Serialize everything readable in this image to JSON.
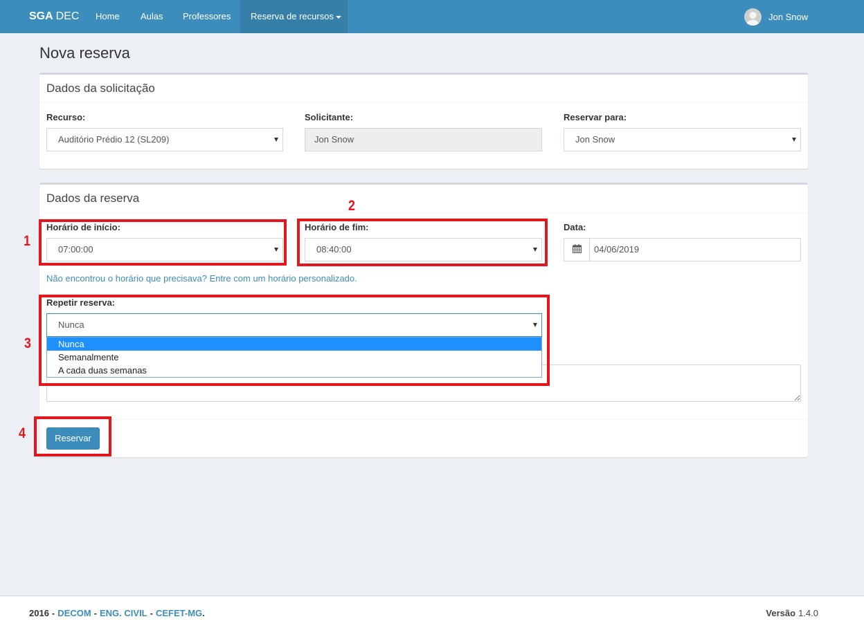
{
  "colors": {
    "navbar": "#3c8dbc",
    "navbar_active": "#367fa9",
    "primary": "#3c8dbc",
    "option_highlight": "#1e90ff",
    "annotation": "#e3161e",
    "page_bg": "#ecf0f5"
  },
  "navbar": {
    "brand": {
      "bold": "SGA",
      "rest": "DEC"
    },
    "items": [
      {
        "label": "Home"
      },
      {
        "label": "Aulas"
      },
      {
        "label": "Professores"
      },
      {
        "label": "Reserva de recursos",
        "active": true,
        "icon": "caret-down-icon"
      }
    ],
    "user": {
      "name": "Jon Snow",
      "icon": "user-avatar-icon"
    }
  },
  "page": {
    "title": "Nova reserva"
  },
  "box_solicitacao": {
    "title": "Dados da solicitação",
    "recurso": {
      "label": "Recurso:",
      "value": "Auditório Prédio 12 (SL209)"
    },
    "solicitante": {
      "label": "Solicitante:",
      "value": "Jon Snow",
      "disabled": true
    },
    "reservar_para": {
      "label": "Reservar para:",
      "value": "Jon Snow"
    }
  },
  "box_reserva": {
    "title": "Dados da reserva",
    "horario_inicio": {
      "label": "Horário de início:",
      "value": "07:00:00"
    },
    "horario_fim": {
      "label": "Horário de fim:",
      "value": "08:40:00"
    },
    "data": {
      "label": "Data:",
      "value": "04/06/2019",
      "icon": "calendar-icon"
    },
    "custom_time_link": "Não encontrou o horário que precisava? Entre com um horário personalizado.",
    "repetir": {
      "label": "Repetir reserva:",
      "value": "Nunca",
      "open": true,
      "options": [
        "Nunca",
        "Semanalmente",
        "A cada duas semanas"
      ],
      "highlighted_index": 0
    },
    "submit_label": "Reservar"
  },
  "annotations": [
    "1",
    "2",
    "3",
    "4"
  ],
  "footer": {
    "year": "2016",
    "separator": "-",
    "links": [
      "DECOM",
      "ENG. CIVIL",
      "CEFET-MG"
    ],
    "end": ".",
    "version_label": "Versão",
    "version": "1.4.0"
  }
}
